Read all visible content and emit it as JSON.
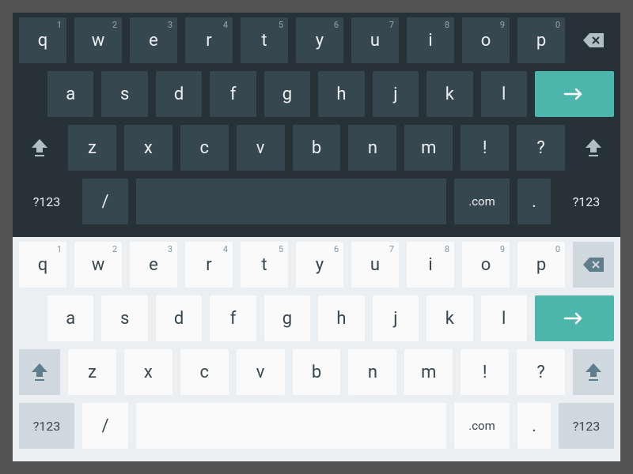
{
  "themes": [
    "dark",
    "light"
  ],
  "colors": {
    "dark_bg": "#263238",
    "dark_key": "#37474f",
    "light_bg": "#eceff1",
    "light_key": "#fafafa",
    "light_fn": "#cfd8dc",
    "accent": "#4db6ac"
  },
  "row1": [
    {
      "label": "q",
      "super": "1"
    },
    {
      "label": "w",
      "super": "2"
    },
    {
      "label": "e",
      "super": "3"
    },
    {
      "label": "r",
      "super": "4"
    },
    {
      "label": "t",
      "super": "5"
    },
    {
      "label": "y",
      "super": "6"
    },
    {
      "label": "u",
      "super": "7"
    },
    {
      "label": "i",
      "super": "8"
    },
    {
      "label": "o",
      "super": "9"
    },
    {
      "label": "p",
      "super": "0"
    }
  ],
  "row2": [
    "a",
    "s",
    "d",
    "f",
    "g",
    "h",
    "j",
    "k",
    "l"
  ],
  "row3": [
    "z",
    "x",
    "c",
    "v",
    "b",
    "n",
    "m",
    "!",
    "?"
  ],
  "row4": {
    "sym": "?123",
    "slash": "/",
    "com": ".com",
    "dot": "."
  },
  "icons": {
    "backspace": "backspace-icon",
    "enter": "arrow-right-icon",
    "shift": "shift-icon"
  }
}
